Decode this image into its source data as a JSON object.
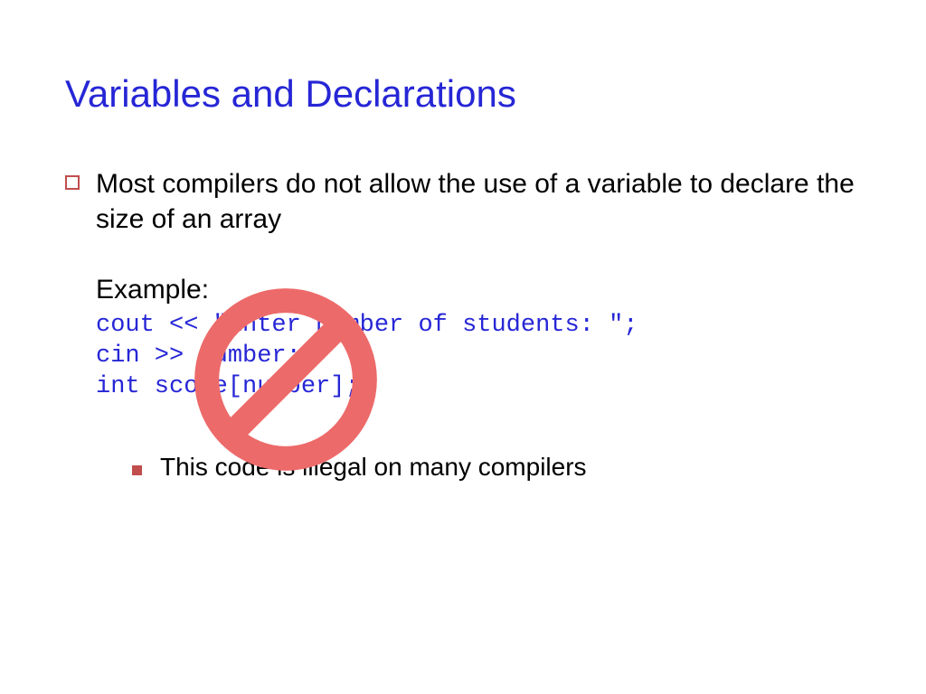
{
  "title": "Variables and Declarations",
  "bullet1": "Most compilers do not allow the use of a variable to declare the size of an array",
  "example_label": "Example:",
  "code_line1": "cout << \"Enter number of students: \";",
  "code_line2": "cin >> number;",
  "code_line3": "int score[number];",
  "sub_bullet": "This code is illegal on many compilers",
  "no_symbol_color": "#ed6a6a"
}
